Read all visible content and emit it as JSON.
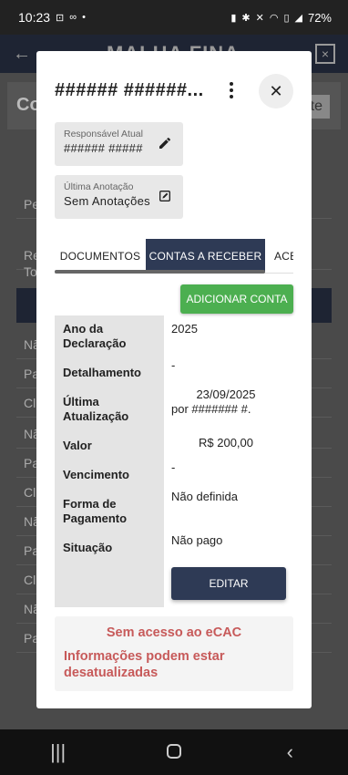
{
  "status_bar": {
    "time": "10:23",
    "left_icons": [
      "screen-record-icon",
      "voicemail-icon"
    ],
    "dot": "•",
    "battery_text": "72%",
    "right_icons": [
      "battery-saver-icon",
      "bluetooth-icon",
      "mute-icon",
      "wifi-icon",
      "volte-icon",
      "signal-icon"
    ]
  },
  "background": {
    "logo": "MALHA FINA",
    "band_left": "Co",
    "band_right": "te",
    "rows": [
      "Pe",
      "Re",
      "To",
      "Nã",
      "Pa",
      "Cli",
      "Nã",
      "Pa",
      "Cli",
      "Nã",
      "Pa",
      "Cli",
      "Nã",
      "Pa"
    ]
  },
  "modal": {
    "title": "###### ######...",
    "responsavel": {
      "label": "Responsável Atual",
      "value": "###### #####"
    },
    "anotacao": {
      "label": "Última Anotação",
      "value": "Sem Anotações"
    },
    "tabs": [
      {
        "label": "DOCUMENTOS"
      },
      {
        "label": "CONTAS A RECEBER"
      },
      {
        "label": "ACE"
      }
    ],
    "add_button": "ADICIONAR CONTA",
    "fields": {
      "ano_label": "Ano da Declaração",
      "ano_value": "2025",
      "detalhamento_label": "Detalhamento",
      "detalhamento_value": "-",
      "atualizacao_label": "Última Atualização",
      "atualizacao_date": "23/09/2025",
      "atualizacao_by": "por ####### #.",
      "valor_label": "Valor",
      "valor_value": "R$ 200,00",
      "vencimento_label": "Vencimento",
      "vencimento_value": "-",
      "forma_label": "Forma de Pagamento",
      "forma_value": "Não definida",
      "situacao_label": "Situação",
      "situacao_value": "Não pago"
    },
    "edit_button": "EDITAR",
    "warning": {
      "title": "Sem acesso ao eCAC",
      "text": "Informações podem estar desatualizadas"
    }
  },
  "colors": {
    "primary": "#2e3a55",
    "success": "#4caf50",
    "warning_text": "#c75a5a"
  }
}
